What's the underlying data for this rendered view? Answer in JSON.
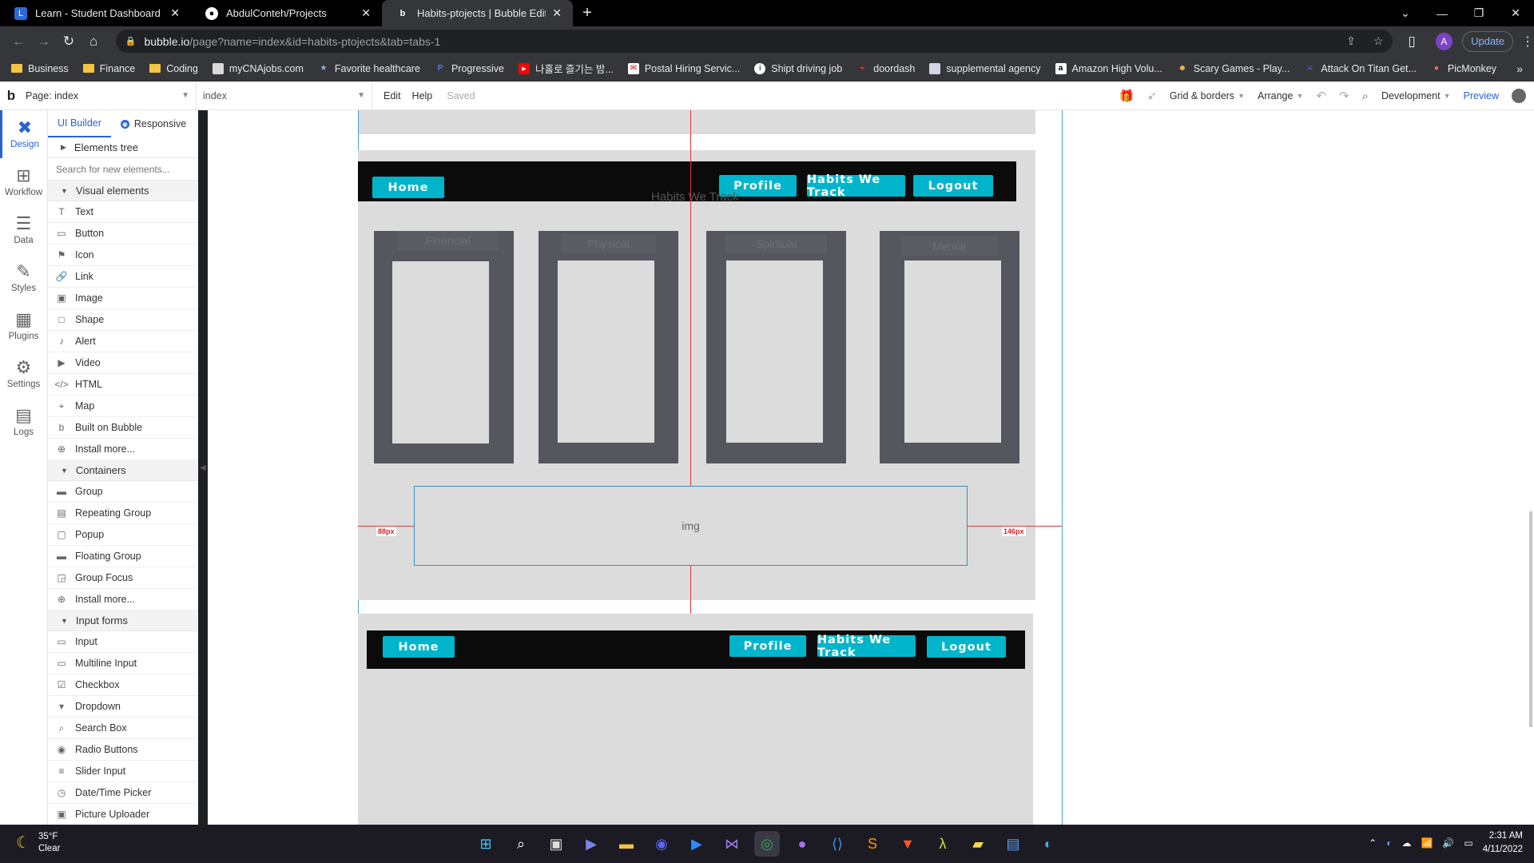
{
  "browser": {
    "tabs": [
      {
        "title": "Learn - Student Dashboard",
        "icon": "learn-favicon",
        "active": false
      },
      {
        "title": "AbdulConteh/Projects",
        "icon": "github-favicon",
        "active": false
      },
      {
        "title": "Habits-ptojects | Bubble Editor",
        "icon": "bubble-favicon",
        "active": true
      }
    ],
    "new_tab": "+",
    "url_host": "bubble.io",
    "url_path": "/page?name=index&id=habits-ptojects&tab=tabs-1",
    "profile_initial": "A",
    "update_label": "Update",
    "bookmarks": [
      {
        "label": "Business",
        "icon": "folder-icon"
      },
      {
        "label": "Finance",
        "icon": "folder-icon"
      },
      {
        "label": "Coding",
        "icon": "folder-icon"
      },
      {
        "label": "myCNAjobs.com",
        "icon": "site-icon"
      },
      {
        "label": "Favorite healthcare",
        "icon": "star-site-icon"
      },
      {
        "label": "Progressive",
        "icon": "progressive-icon"
      },
      {
        "label": "나홀로 즐기는 밤...",
        "icon": "youtube-icon"
      },
      {
        "label": "Postal Hiring Servic...",
        "icon": "postal-icon"
      },
      {
        "label": "Shipt driving job",
        "icon": "info-icon"
      },
      {
        "label": "doordash",
        "icon": "doordash-icon"
      },
      {
        "label": "supplemental agency",
        "icon": "doc-icon"
      },
      {
        "label": "Amazon High Volu...",
        "icon": "amazon-icon"
      },
      {
        "label": "Scary Games - Play...",
        "icon": "game-icon"
      },
      {
        "label": "Attack On Titan Get...",
        "icon": "aot-icon"
      },
      {
        "label": "PicMonkey",
        "icon": "picmonkey-icon"
      }
    ]
  },
  "editor": {
    "page_select": "Page: index",
    "element_select": "index",
    "menu_edit": "Edit",
    "menu_help": "Help",
    "status": "Saved",
    "grid_borders": "Grid & borders",
    "arrange": "Arrange",
    "environment": "Development",
    "preview": "Preview"
  },
  "rail": [
    {
      "label": "Design",
      "icon": "design-icon",
      "glyph": "✖",
      "active": true
    },
    {
      "label": "Workflow",
      "icon": "workflow-icon",
      "glyph": "⊞",
      "active": false
    },
    {
      "label": "Data",
      "icon": "database-icon",
      "glyph": "☰",
      "active": false
    },
    {
      "label": "Styles",
      "icon": "brush-icon",
      "glyph": "✎",
      "active": false
    },
    {
      "label": "Plugins",
      "icon": "plugins-icon",
      "glyph": "▦",
      "active": false
    },
    {
      "label": "Settings",
      "icon": "gear-icon",
      "glyph": "⚙",
      "active": false
    },
    {
      "label": "Logs",
      "icon": "logs-icon",
      "glyph": "▤",
      "active": false
    }
  ],
  "panel": {
    "tab_ui_builder": "UI Builder",
    "tab_responsive": "Responsive",
    "elements_tree": "Elements tree",
    "search_placeholder": "Search for new elements...",
    "visual_elements_title": "Visual elements",
    "visual_elements": [
      {
        "label": "Text",
        "icon": "text-icon",
        "glyph": "T"
      },
      {
        "label": "Button",
        "icon": "button-icon",
        "glyph": "▭"
      },
      {
        "label": "Icon",
        "icon": "flag-icon",
        "glyph": "⚑"
      },
      {
        "label": "Link",
        "icon": "link-icon",
        "glyph": "🔗"
      },
      {
        "label": "Image",
        "icon": "image-icon",
        "glyph": "▣"
      },
      {
        "label": "Shape",
        "icon": "shape-icon",
        "glyph": "□"
      },
      {
        "label": "Alert",
        "icon": "bell-icon",
        "glyph": "♪"
      },
      {
        "label": "Video",
        "icon": "video-icon",
        "glyph": "▶"
      },
      {
        "label": "HTML",
        "icon": "code-icon",
        "glyph": "</>"
      },
      {
        "label": "Map",
        "icon": "map-pin-icon",
        "glyph": "⌖"
      },
      {
        "label": "Built on Bubble",
        "icon": "bubble-b-icon",
        "glyph": "b"
      },
      {
        "label": "Install more...",
        "icon": "plus-circle-icon",
        "glyph": "⊕"
      }
    ],
    "containers_title": "Containers",
    "containers": [
      {
        "label": "Group",
        "icon": "folder-icon",
        "glyph": "▬"
      },
      {
        "label": "Repeating Group",
        "icon": "repeating-group-icon",
        "glyph": "▤"
      },
      {
        "label": "Popup",
        "icon": "popup-icon",
        "glyph": "▢"
      },
      {
        "label": "Floating Group",
        "icon": "floating-group-icon",
        "glyph": "▬"
      },
      {
        "label": "Group Focus",
        "icon": "group-focus-icon",
        "glyph": "◲"
      },
      {
        "label": "Install more...",
        "icon": "plus-circle-icon",
        "glyph": "⊕"
      }
    ],
    "input_forms_title": "Input forms",
    "input_forms": [
      {
        "label": "Input",
        "icon": "input-icon",
        "glyph": "▭"
      },
      {
        "label": "Multiline Input",
        "icon": "multiline-input-icon",
        "glyph": "▭"
      },
      {
        "label": "Checkbox",
        "icon": "checkbox-icon",
        "glyph": "☑"
      },
      {
        "label": "Dropdown",
        "icon": "dropdown-icon",
        "glyph": "▾"
      },
      {
        "label": "Search Box",
        "icon": "search-icon",
        "glyph": "⌕"
      },
      {
        "label": "Radio Buttons",
        "icon": "radio-icon",
        "glyph": "◉"
      },
      {
        "label": "Slider Input",
        "icon": "slider-icon",
        "glyph": "≡"
      },
      {
        "label": "Date/Time Picker",
        "icon": "clock-icon",
        "glyph": "◷"
      },
      {
        "label": "Picture Uploader",
        "icon": "picture-uploader-icon",
        "glyph": "▣"
      }
    ]
  },
  "canvas": {
    "nav_top": {
      "home": "Home",
      "profile": "Profile",
      "habits": "Habits We Track",
      "logout": "Logout"
    },
    "heading": "Habits We Track",
    "cards": [
      {
        "label": "Financial"
      },
      {
        "label": "Physical"
      },
      {
        "label": "Spiritual"
      },
      {
        "label": "Mental"
      }
    ],
    "img_label": "img",
    "left_distance": "88px",
    "right_distance": "146px",
    "nav_bottom": {
      "home": "Home",
      "profile": "Profile",
      "habits": "Habits We Track",
      "logout": "Logout"
    },
    "button_color": "#00b5cb",
    "navbar_color": "#0b0b0b",
    "card_color": "#55565e"
  },
  "taskbar": {
    "temperature": "35°F",
    "condition": "Clear",
    "apps": [
      "windows-start-icon",
      "search-icon",
      "task-view-icon",
      "teams-icon",
      "file-explorer-icon",
      "discord-icon",
      "zoom-icon",
      "visual-studio-icon",
      "chrome-icon",
      "github-desktop-icon",
      "vscode-icon",
      "sublime-icon",
      "brave-icon",
      "lambda-icon",
      "sticky-notes-icon",
      "notepad-icon",
      "edge-icon"
    ],
    "time": "2:31 AM",
    "date": "4/11/2022"
  }
}
